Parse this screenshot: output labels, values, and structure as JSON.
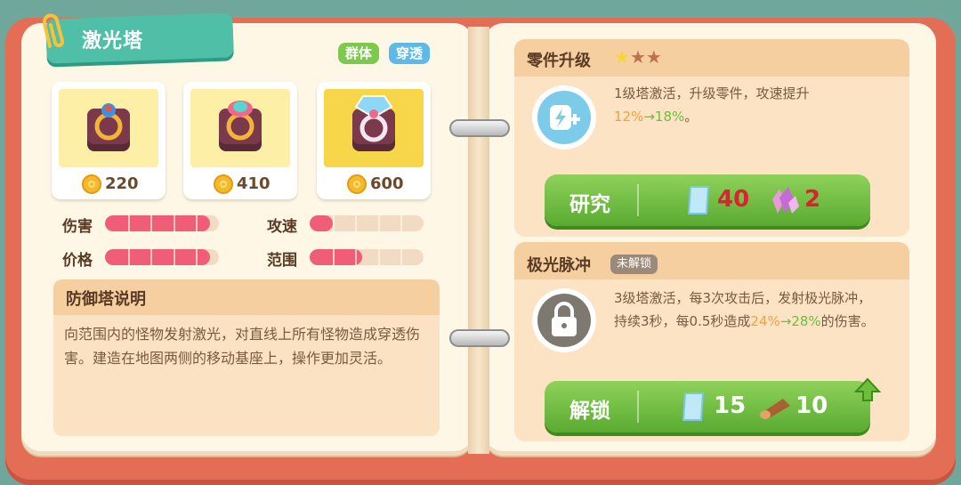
{
  "tower": {
    "name": "激光塔",
    "tags": [
      "群体",
      "穿透"
    ],
    "levels": [
      {
        "cost": "220"
      },
      {
        "cost": "410"
      },
      {
        "cost": "600"
      }
    ],
    "stats": [
      {
        "label": "伤害",
        "value": 0.92
      },
      {
        "label": "攻速",
        "value": 0.2
      },
      {
        "label": "价格",
        "value": 0.92
      },
      {
        "label": "范围",
        "value": 0.46
      }
    ],
    "description": {
      "title": "防御塔说明",
      "text": "向范围内的怪物发射激光，对直线上所有怪物造成穿透伤害。建造在地图两侧的移动基座上，操作更加灵活。"
    }
  },
  "upgrade": {
    "title": "零件升级",
    "stars": 3,
    "stars_filled": 1,
    "text_prefix": "1级塔激活，升级零件，攻速提升",
    "from": "12%",
    "arrow": "→",
    "to": "18%",
    "text_suffix": "。",
    "button_label": "研究",
    "cost_paper": "40",
    "cost_crystal": "2"
  },
  "aurora": {
    "title": "极光脉冲",
    "badge": "未解锁",
    "text_prefix": "3级塔激活，每3次攻击后，发射极光脉冲，持续3秒，每0.5秒造成",
    "from": "24%",
    "arrow": "→",
    "to": "28%",
    "text_suffix": "的伤害。",
    "button_label": "解锁",
    "cost_paper": "15",
    "cost_wood": "10"
  },
  "colors": {
    "accent_teal": "#4fc0a7",
    "button_green": "#6bbf3a",
    "bar_red": "#ef5e76",
    "cover_red": "#e36d55"
  }
}
